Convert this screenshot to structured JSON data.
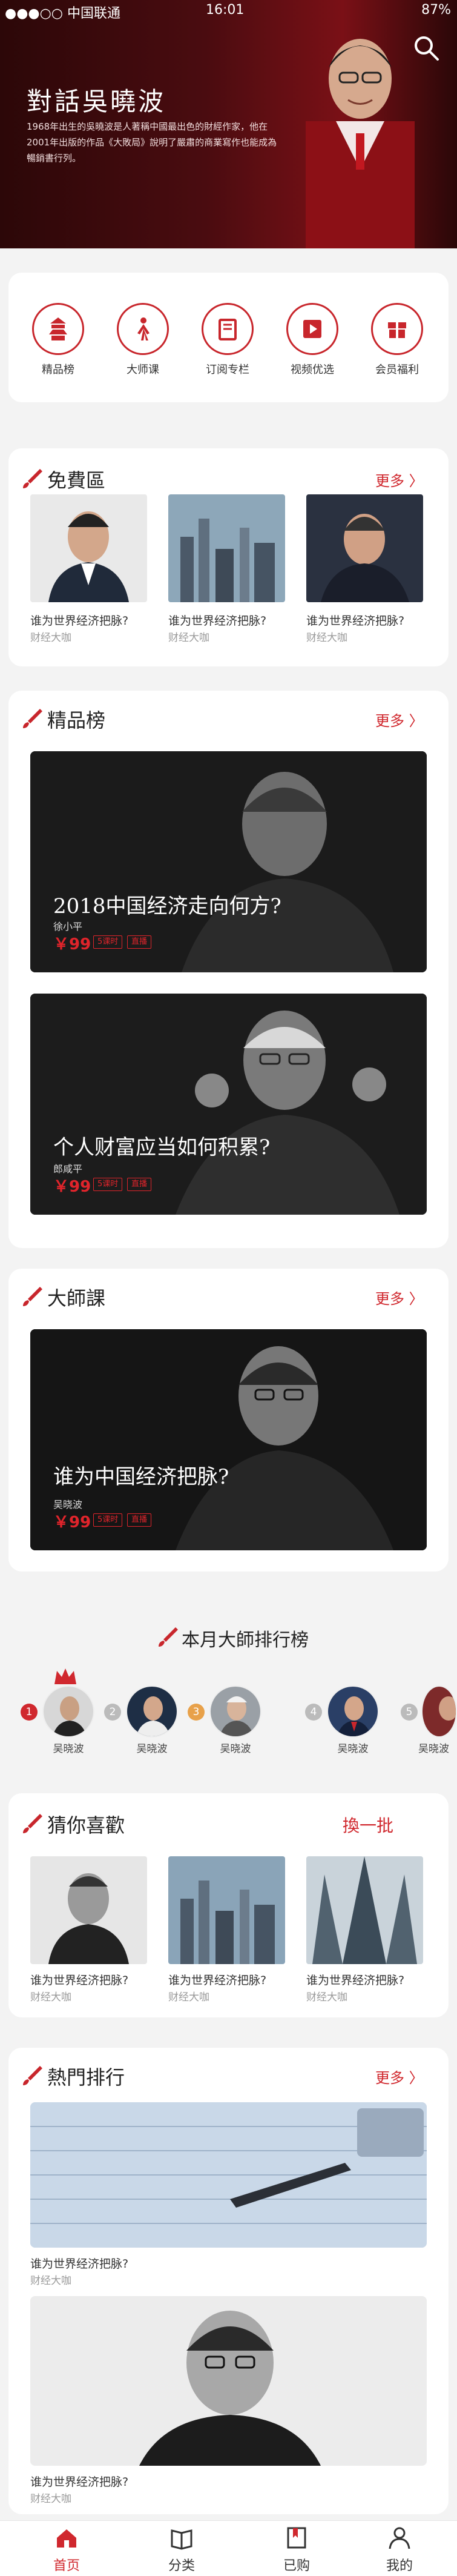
{
  "status_bar": {
    "carrier": "●●●○○ 中国联通",
    "time": "16:01",
    "battery": "87%"
  },
  "hero": {
    "title": "對話吳曉波",
    "description": "1968年出生的吳曉波是人著稱中國最出色的財經作家，他在2001年出版的作品《大敗局》說明了嚴肅的商業寫作也能成為暢銷書行列。"
  },
  "quick_nav": [
    {
      "label": "精品榜",
      "icon": "pagoda-icon"
    },
    {
      "label": "大师课",
      "icon": "brush-figure-icon"
    },
    {
      "label": "订阅专栏",
      "icon": "book-icon"
    },
    {
      "label": "视频优选",
      "icon": "video-icon"
    },
    {
      "label": "会员福利",
      "icon": "gift-icon"
    }
  ],
  "free_section": {
    "title": "免費區",
    "more": "更多 〉",
    "items": [
      {
        "title": "谁为世界经济把脉?",
        "sub": "财经大咖"
      },
      {
        "title": "谁为世界经济把脉?",
        "sub": "财经大咖"
      },
      {
        "title": "谁为世界经济把脉?",
        "sub": "财经大咖"
      }
    ]
  },
  "premium_section": {
    "title": "精品榜",
    "more": "更多 〉",
    "banners": [
      {
        "title": "2018中国经济走向何方?",
        "author": "徐小平",
        "price": "￥99",
        "tags": [
          "5课时",
          "直播"
        ]
      },
      {
        "title": "个人财富应当如何积累?",
        "author": "郎咸平",
        "price": "￥99",
        "tags": [
          "5课时",
          "直播"
        ]
      }
    ]
  },
  "master_section": {
    "title": "大師課",
    "more": "更多 〉",
    "banner": {
      "title": "谁为中国经济把脉?",
      "author": "吴晓波",
      "price": "￥99",
      "tags": [
        "5课时",
        "直播"
      ]
    }
  },
  "ranking_section": {
    "title": "本月大師排行榜",
    "items": [
      {
        "rank": "1",
        "name": "吴晓波"
      },
      {
        "rank": "2",
        "name": "吴晓波"
      },
      {
        "rank": "3",
        "name": "吴晓波"
      },
      {
        "rank": "4",
        "name": "吴晓波"
      },
      {
        "rank": "5",
        "name": "吴晓波"
      }
    ]
  },
  "guess_section": {
    "title": "猜你喜歡",
    "more": "換一批",
    "items": [
      {
        "title": "谁为世界经济把脉?",
        "sub": "财经大咖"
      },
      {
        "title": "谁为世界经济把脉?",
        "sub": "财经大咖"
      },
      {
        "title": "谁为世界经济把脉?",
        "sub": "财经大咖"
      }
    ]
  },
  "hot_section": {
    "title": "熱門排行",
    "more": "更多 〉",
    "items": [
      {
        "title": "谁为世界经济把脉?",
        "sub": "财经大咖"
      },
      {
        "title": "谁为世界经济把脉?",
        "sub": "财经大咖"
      }
    ]
  },
  "tabbar": [
    {
      "label": "首页",
      "icon": "home-icon",
      "active": true
    },
    {
      "label": "分类",
      "icon": "book-open-icon",
      "active": false
    },
    {
      "label": "已购",
      "icon": "bookmark-icon",
      "active": false
    },
    {
      "label": "我的",
      "icon": "person-icon",
      "active": false
    }
  ],
  "colors": {
    "accent": "#d0282e",
    "hero_bg": "#4a0c10"
  }
}
